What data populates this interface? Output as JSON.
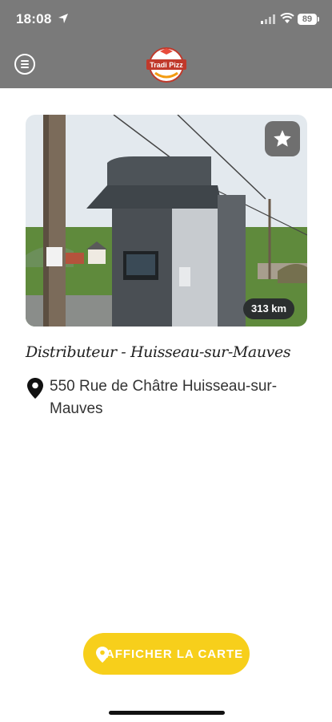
{
  "status": {
    "time": "18:08",
    "battery": "89"
  },
  "header": {
    "logo_text": "Tradi Pizz"
  },
  "card": {
    "distance": "313 km"
  },
  "place": {
    "title": "Distributeur - Huisseau-sur-Mauves",
    "address": "550 Rue de Châtre Huisseau-sur-Mauves"
  },
  "actions": {
    "map_button_label": "AFFICHER LA CARTE"
  },
  "colors": {
    "header_bg": "#7a7a7a",
    "accent_yellow": "#f7cf1b",
    "badge_bg": "#2b2f2f"
  }
}
